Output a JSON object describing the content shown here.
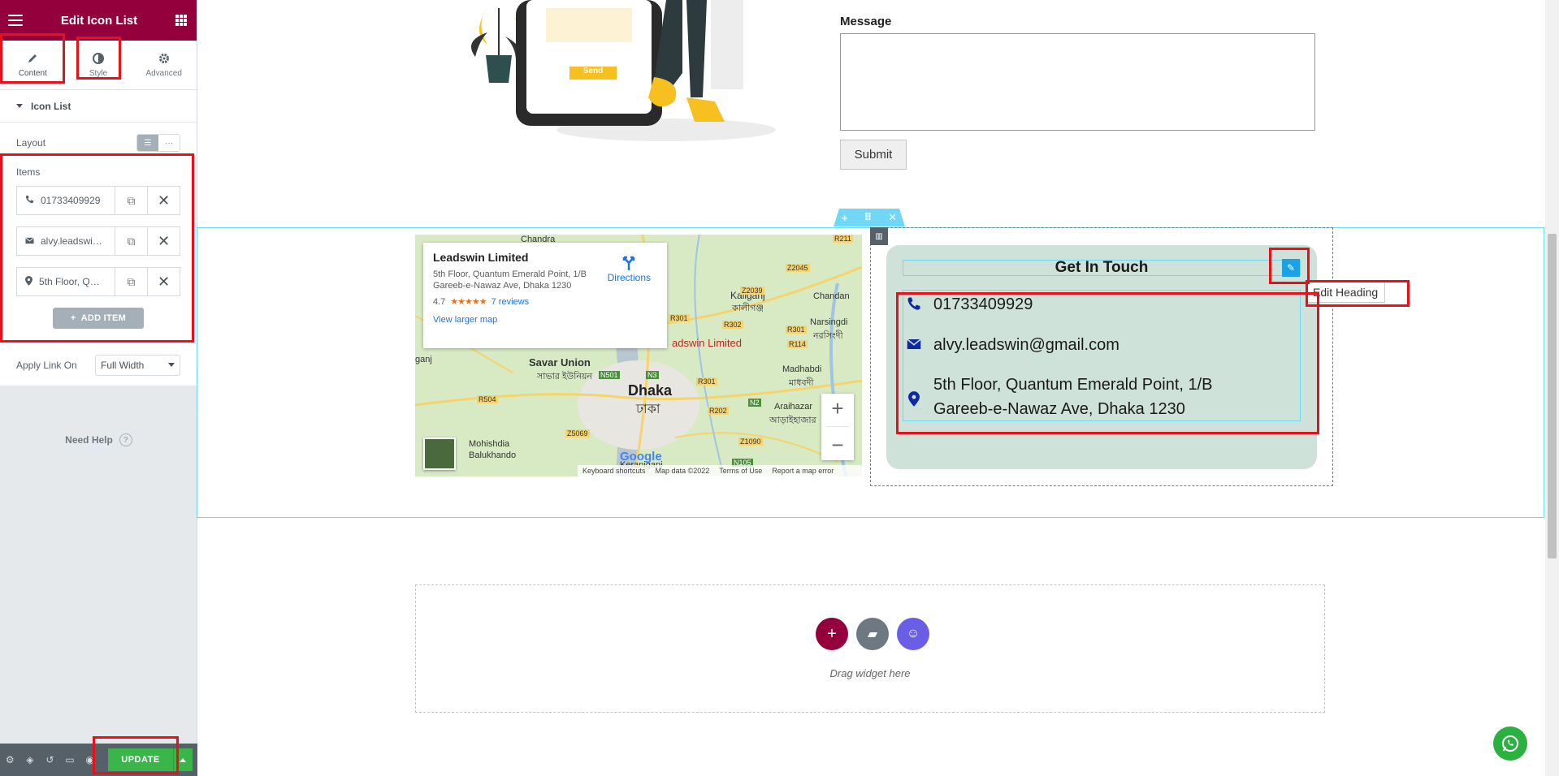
{
  "panel": {
    "title": "Edit Icon List",
    "tabs": [
      {
        "label": "Content",
        "icon": "pencil-icon"
      },
      {
        "label": "Style",
        "icon": "half-circle-icon"
      },
      {
        "label": "Advanced",
        "icon": "gear-icon"
      }
    ],
    "section_title": "Icon List",
    "layout_label": "Layout",
    "items_label": "Items",
    "items": [
      {
        "text": "01733409929",
        "icon": "phone-icon"
      },
      {
        "text": "alvy.leadswin@gmail.com",
        "icon": "envelope-icon"
      },
      {
        "text": "5th Floor, Quantum Emerald Point, 1/B Gareeb-e-Nawaz Ave, Dhaka 1230",
        "icon": "map-pin-icon"
      }
    ],
    "add_item_label": "ADD ITEM",
    "apply_link_label": "Apply Link On",
    "apply_link_value": "Full Width",
    "need_help": "Need Help",
    "update_label": "UPDATE"
  },
  "form": {
    "message_label": "Message",
    "submit_label": "Submit",
    "illustration_button": "Send"
  },
  "map": {
    "place_name": "Leadswin Limited",
    "address": "5th Floor, Quantum Emerald Point, 1/B Gareeb-e-Nawaz Ave, Dhaka 1230",
    "rating": "4.7",
    "stars": "★★★★★",
    "reviews": "7 reviews",
    "directions": "Directions",
    "view_larger": "View larger map",
    "labels": {
      "chandra": "Chandra",
      "savar": "Savar Union",
      "savar_bn": "সাভার ইউনিয়ন",
      "dhaka": "Dhaka",
      "dhaka_bn": "ঢাকা",
      "kaliganj": "Kaliganj",
      "kaliganj_bn": "কালীগঞ্জ",
      "narsingdi": "Narsingdi",
      "narsingdi_bn": "নরসিংদী",
      "madhabdi": "Madhabdi",
      "madhabdi_bn": "মাধবদী",
      "araihazar": "Araihazar",
      "araihazar_bn": "আড়াইহাজার",
      "mohishdia": "Mohishdia",
      "balukhando": "Balukhando",
      "keraniganj": "Keraniganj",
      "chandan": "Chandan",
      "marker": "adswin Limited",
      "ganj": "ganj",
      "r504": "R504",
      "n501": "N501",
      "n3": "N3",
      "r301": "R301",
      "r302": "R302",
      "z2045": "Z2045",
      "z2039": "Z2039",
      "r114": "R114",
      "r202": "R202",
      "z5069": "Z5069",
      "z1090": "Z1090",
      "n105": "N105",
      "n2": "N2",
      "r211": "R211"
    },
    "google": "Google",
    "footer": [
      "Keyboard shortcuts",
      "Map data ©2022",
      "Terms of Use",
      "Report a map error"
    ]
  },
  "contact": {
    "heading": "Get In Touch",
    "edit_tooltip": "Edit Heading"
  },
  "empty_section": {
    "drag_text": "Drag widget here"
  },
  "colors": {
    "brand": "#93003c",
    "accent": "#71d7f7",
    "card": "#cfe2d9",
    "update": "#39b54a",
    "icon_blue": "#0c2aa5"
  }
}
